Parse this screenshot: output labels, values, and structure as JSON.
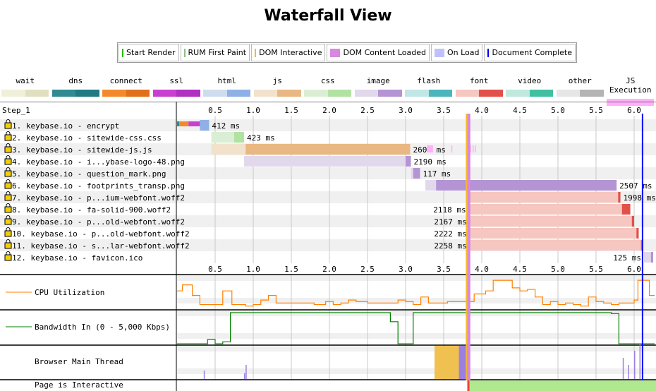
{
  "title": "Waterfall View",
  "milestones": [
    {
      "label": "Start Render",
      "color": "#28bc00",
      "mark": "line"
    },
    {
      "label": "RUM First Paint",
      "color": "#8fbc83",
      "mark": "line"
    },
    {
      "label": "DOM Interactive",
      "color": "#f5b92c",
      "mark": "line"
    },
    {
      "label": "DOM Content Loaded",
      "color": "#d888df",
      "mark": "box"
    },
    {
      "label": "On Load",
      "color": "#c0c0ff",
      "mark": "box"
    },
    {
      "label": "Document Complete",
      "color": "#0000ff",
      "mark": "line"
    }
  ],
  "request_types": [
    {
      "label": "wait",
      "c1": "#f0f0d8",
      "c2": "#e0e0c0"
    },
    {
      "label": "dns",
      "c1": "#2f8a91",
      "c2": "#1f7a81"
    },
    {
      "label": "connect",
      "c1": "#f28a2c",
      "c2": "#e0701a"
    },
    {
      "label": "ssl",
      "c1": "#c840d0",
      "c2": "#b030c0"
    },
    {
      "label": "html",
      "c1": "#cfdcee",
      "c2": "#8eb0e6"
    },
    {
      "label": "js",
      "c1": "#f2e2cc",
      "c2": "#e9b882"
    },
    {
      "label": "css",
      "c1": "#daeed4",
      "c2": "#b2e2a2"
    },
    {
      "label": "image",
      "c1": "#e2d8ec",
      "c2": "#b494d4"
    },
    {
      "label": "flash",
      "c1": "#c0e6e6",
      "c2": "#4ab6bc"
    },
    {
      "label": "font",
      "c1": "#f6c6c0",
      "c2": "#e2504a"
    },
    {
      "label": "video",
      "c1": "#c0e8dc",
      "c2": "#40c0a0"
    },
    {
      "label": "other",
      "c1": "#e6e6e6",
      "c2": "#b4b4b4"
    },
    {
      "label": "JS Execution",
      "c1": "#ffb0f8",
      "c2": "#ffb0f8"
    }
  ],
  "step_label": "Step_1",
  "axis": {
    "ticks": [
      0.5,
      1.0,
      1.5,
      2.0,
      2.5,
      3.0,
      3.5,
      4.0,
      4.5,
      5.0,
      5.5,
      6.0
    ],
    "max": 6.27
  },
  "markers": {
    "dom_interactive": 3.8,
    "dom_content_loaded": [
      3.81,
      3.85
    ],
    "document_complete": 6.11
  },
  "requests": [
    {
      "label": " 1. keybase.io - encrypt",
      "type": "html",
      "start": 0.0,
      "ttfb": 0.3,
      "end": 0.42,
      "dns": [
        0,
        0.03
      ],
      "connect": [
        0.03,
        0.15
      ],
      "ssl": [
        0.15,
        0.3
      ],
      "duration": "412 ms",
      "label_side": "right"
    },
    {
      "label": " 2. keybase.io - sitewide-css.css",
      "type": "css",
      "start": 0.45,
      "ttfb": 0.75,
      "end": 0.88,
      "duration": "423 ms",
      "label_side": "right"
    },
    {
      "label": " 3. keybase.io - sitewide-js.js",
      "type": "js",
      "start": 0.45,
      "ttfb": 0.9,
      "end": 3.06,
      "duration": "2607 ms",
      "label_side": "right"
    },
    {
      "label": " 4. keybase.io - i...ybase-logo-48.png",
      "type": "image",
      "start": 0.88,
      "ttfb": 3.0,
      "end": 3.07,
      "duration": "2190 ms",
      "label_side": "right"
    },
    {
      "label": " 5. keybase.io - question_mark.png",
      "type": "image",
      "start": 3.07,
      "ttfb": 3.1,
      "end": 3.19,
      "duration": "117 ms",
      "label_side": "right"
    },
    {
      "label": " 6. keybase.io - footprints_transp.png",
      "type": "image",
      "start": 3.26,
      "ttfb": 3.4,
      "end": 5.77,
      "duration": "2507 ms",
      "label_side": "right"
    },
    {
      "label": " 7. keybase.io - p...ium-webfont.woff2",
      "type": "font",
      "start": 3.83,
      "ttfb": 5.79,
      "end": 5.82,
      "duration": "1998 ms",
      "label_side": "right"
    },
    {
      "label": " 8. keybase.io - fa-solid-900.woff2",
      "type": "font",
      "start": 3.83,
      "ttfb": 5.84,
      "end": 5.95,
      "duration": "2118 ms",
      "label_side": "left"
    },
    {
      "label": " 9. keybase.io - p...old-webfont.woff2",
      "type": "font",
      "start": 3.84,
      "ttfb": 5.97,
      "end": 6.0,
      "duration": "2167 ms",
      "label_side": "left"
    },
    {
      "label": "10. keybase.io - p...old-webfont.woff2",
      "type": "font",
      "start": 3.84,
      "ttfb": 6.03,
      "end": 6.06,
      "duration": "2222 ms",
      "label_side": "left"
    },
    {
      "label": "11. keybase.io - s...lar-webfont.woff2",
      "type": "font",
      "start": 3.84,
      "ttfb": 6.09,
      "end": 6.1,
      "duration": "2258 ms",
      "label_side": "left"
    },
    {
      "label": "12. keybase.io - favicon.ico",
      "type": "image",
      "start": 6.13,
      "ttfb": 6.22,
      "end": 6.25,
      "duration": "125 ms",
      "label_side": "left"
    }
  ],
  "js_execution": [
    [
      3.6,
      3.61
    ],
    [
      3.28,
      3.36
    ],
    [
      3.81,
      3.86
    ],
    [
      3.88,
      3.89
    ],
    [
      3.91,
      3.92
    ],
    [
      6.1,
      6.12
    ]
  ],
  "graphs": {
    "cpu": {
      "label": "CPU Utilization",
      "color": "#ff8000",
      "points": [
        [
          0,
          60
        ],
        [
          0.07,
          60
        ],
        [
          0.07,
          80
        ],
        [
          0.2,
          80
        ],
        [
          0.2,
          45
        ],
        [
          0.3,
          45
        ],
        [
          0.3,
          15
        ],
        [
          0.6,
          15
        ],
        [
          0.6,
          60
        ],
        [
          0.72,
          60
        ],
        [
          0.72,
          15
        ],
        [
          0.9,
          15
        ],
        [
          0.9,
          10
        ],
        [
          1.0,
          10
        ],
        [
          1.0,
          15
        ],
        [
          1.1,
          15
        ],
        [
          1.1,
          30
        ],
        [
          1.2,
          30
        ],
        [
          1.2,
          45
        ],
        [
          1.3,
          45
        ],
        [
          1.3,
          20
        ],
        [
          1.8,
          20
        ],
        [
          1.8,
          15
        ],
        [
          1.95,
          15
        ],
        [
          1.95,
          25
        ],
        [
          2.05,
          25
        ],
        [
          2.05,
          15
        ],
        [
          2.15,
          15
        ],
        [
          2.15,
          20
        ],
        [
          2.25,
          20
        ],
        [
          2.25,
          30
        ],
        [
          2.35,
          30
        ],
        [
          2.35,
          25
        ],
        [
          2.5,
          25
        ],
        [
          2.5,
          20
        ],
        [
          2.9,
          20
        ],
        [
          2.9,
          30
        ],
        [
          3.0,
          30
        ],
        [
          3.0,
          25
        ],
        [
          3.1,
          25
        ],
        [
          3.1,
          15
        ],
        [
          3.2,
          15
        ],
        [
          3.2,
          40
        ],
        [
          3.3,
          40
        ],
        [
          3.3,
          20
        ],
        [
          3.55,
          20
        ],
        [
          3.55,
          25
        ],
        [
          3.9,
          25
        ],
        [
          3.9,
          50
        ],
        [
          4.05,
          50
        ],
        [
          4.05,
          60
        ],
        [
          4.15,
          60
        ],
        [
          4.15,
          95
        ],
        [
          4.4,
          95
        ],
        [
          4.4,
          70
        ],
        [
          4.5,
          70
        ],
        [
          4.5,
          60
        ],
        [
          4.6,
          60
        ],
        [
          4.6,
          65
        ],
        [
          4.7,
          65
        ],
        [
          4.7,
          40
        ],
        [
          4.8,
          40
        ],
        [
          4.8,
          15
        ]
      ],
      "points_tail": [
        [
          4.8,
          15
        ],
        [
          4.9,
          15
        ],
        [
          4.9,
          25
        ],
        [
          5.0,
          25
        ],
        [
          5.0,
          15
        ],
        [
          5.1,
          15
        ],
        [
          5.1,
          20
        ],
        [
          5.2,
          20
        ],
        [
          5.2,
          15
        ],
        [
          5.3,
          15
        ],
        [
          5.3,
          10
        ],
        [
          5.4,
          10
        ],
        [
          5.4,
          40
        ],
        [
          5.5,
          40
        ],
        [
          5.5,
          25
        ],
        [
          5.6,
          25
        ],
        [
          5.6,
          20
        ],
        [
          5.7,
          20
        ],
        [
          5.7,
          15
        ],
        [
          5.8,
          15
        ],
        [
          5.8,
          20
        ],
        [
          6.0,
          20
        ],
        [
          6.0,
          30
        ],
        [
          6.05,
          30
        ],
        [
          6.05,
          95
        ],
        [
          6.2,
          95
        ],
        [
          6.2,
          45
        ],
        [
          6.27,
          45
        ]
      ]
    },
    "bandwidth": {
      "label": "Bandwidth In (0 - 5,000 Kbps)",
      "color": "#008000",
      "points": [
        [
          0,
          2
        ],
        [
          0.4,
          2
        ],
        [
          0.4,
          15
        ],
        [
          0.5,
          15
        ],
        [
          0.5,
          2
        ],
        [
          0.6,
          2
        ],
        [
          0.6,
          8
        ],
        [
          0.7,
          8
        ],
        [
          0.7,
          98
        ],
        [
          2.8,
          98
        ],
        [
          2.8,
          70
        ],
        [
          2.9,
          70
        ],
        [
          2.9,
          2
        ],
        [
          3.1,
          2
        ],
        [
          3.1,
          98
        ],
        [
          5.7,
          98
        ],
        [
          5.7,
          95
        ],
        [
          5.8,
          95
        ],
        [
          5.8,
          2
        ],
        [
          6.27,
          2
        ]
      ]
    },
    "main_thread": {
      "label": "Browser Main Thread"
    },
    "interactive": {
      "label": "Page is Interactive",
      "blocked_color": "#f04030",
      "interactive_color": "#b0e890",
      "interactive_from": 3.84,
      "blocked": [
        3.81,
        3.84
      ]
    }
  }
}
